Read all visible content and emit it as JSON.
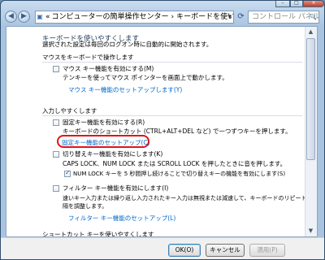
{
  "titlebar": {
    "minimize": "–",
    "maximize": "□",
    "close": "×"
  },
  "addressbar": {
    "back_icon": "◀",
    "forward_icon": "▶",
    "dropdown_icon": "▾",
    "refresh_icon": "⟳",
    "search_icon": "🔍",
    "crumb_sep1": "«",
    "crumb_parent": "コンピューターの簡単操作センター",
    "crumb_sep2": "›",
    "crumb_current": "キーボードを使いやすくします",
    "search_placeholder": "コントロール パネルの検索"
  },
  "content": {
    "heading": "キーボードを使いやすくします",
    "subheading": "選択された設定は毎回のログオン時に自動的に開始されます。",
    "mouse_section": {
      "title": "マウスをキーボードで操作します",
      "mousekeys_label": "マウス キー機能を有効にする(M)",
      "mousekeys_checked": false,
      "mousekeys_desc": "テンキーを使ってマウス ポインターを画面上で動かします。",
      "mousekeys_link": "マウス キー機能のセットアップします(Y)"
    },
    "typing_section": {
      "title": "入力しやすくします",
      "sticky_label": "固定キー機能を有効にする(R)",
      "sticky_checked": false,
      "sticky_desc": "キーボードのショートカット (CTRL+ALT+DEL など) で一つずつキーを押します。",
      "sticky_link": "固定キー機能のセットアップ(C)",
      "toggle_label": "切り替えキー機能を有効にします(K)",
      "toggle_checked": false,
      "toggle_desc": "CAPS LOCK、NUM LOCK または SCROLL LOCK を押したときに音を押します。",
      "numlock_label": "NUM LOCK キーを 5 秒間押し続けることで切り替えキーの機能を有効にします(S)",
      "numlock_checked": true,
      "filter_label": "フィルター キー機能を有効にします(I)",
      "filter_checked": false,
      "filter_desc1": "速いキー入力または繰り返し入力されたキー入力は無視または減速して、キーボードのリピート間",
      "filter_desc2": "隔を調整します。",
      "filter_link": "フィルター キー機能のセットアップ(L)"
    },
    "shortcut_section": {
      "title": "ショートカット キーを使いやすくします"
    }
  },
  "buttons": {
    "ok": "OK(O)",
    "cancel": "キャンセル",
    "apply": "適用(P)"
  },
  "colors": {
    "link": "#0066cc",
    "highlight_oval": "#e0141a"
  }
}
